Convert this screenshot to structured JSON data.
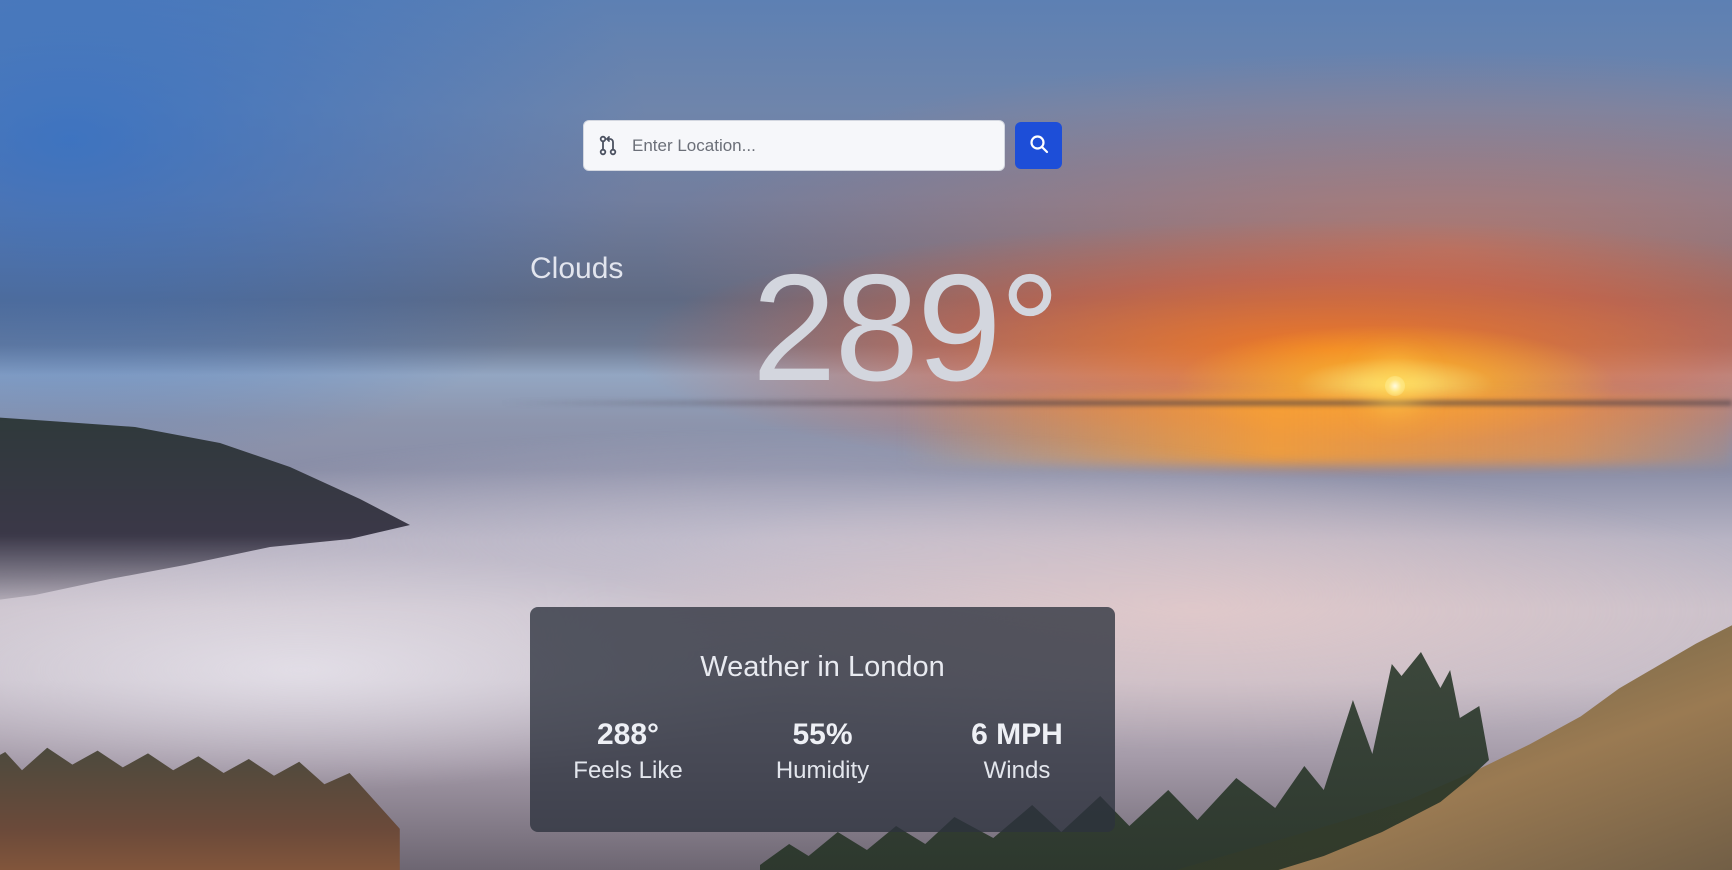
{
  "search": {
    "placeholder": "Enter Location...",
    "value": ""
  },
  "current": {
    "condition": "Clouds",
    "temperature": "289°"
  },
  "details": {
    "title": "Weather in London",
    "stats": [
      {
        "value": "288°",
        "label": "Feels Like"
      },
      {
        "value": "55%",
        "label": "Humidity"
      },
      {
        "value": "6 MPH",
        "label": "Winds"
      }
    ]
  },
  "icons": {
    "location": "git-pull-request-icon",
    "search": "search-icon"
  },
  "colors": {
    "accent": "#1d4ed8",
    "card_bg": "rgba(45,50,62,0.78)"
  }
}
